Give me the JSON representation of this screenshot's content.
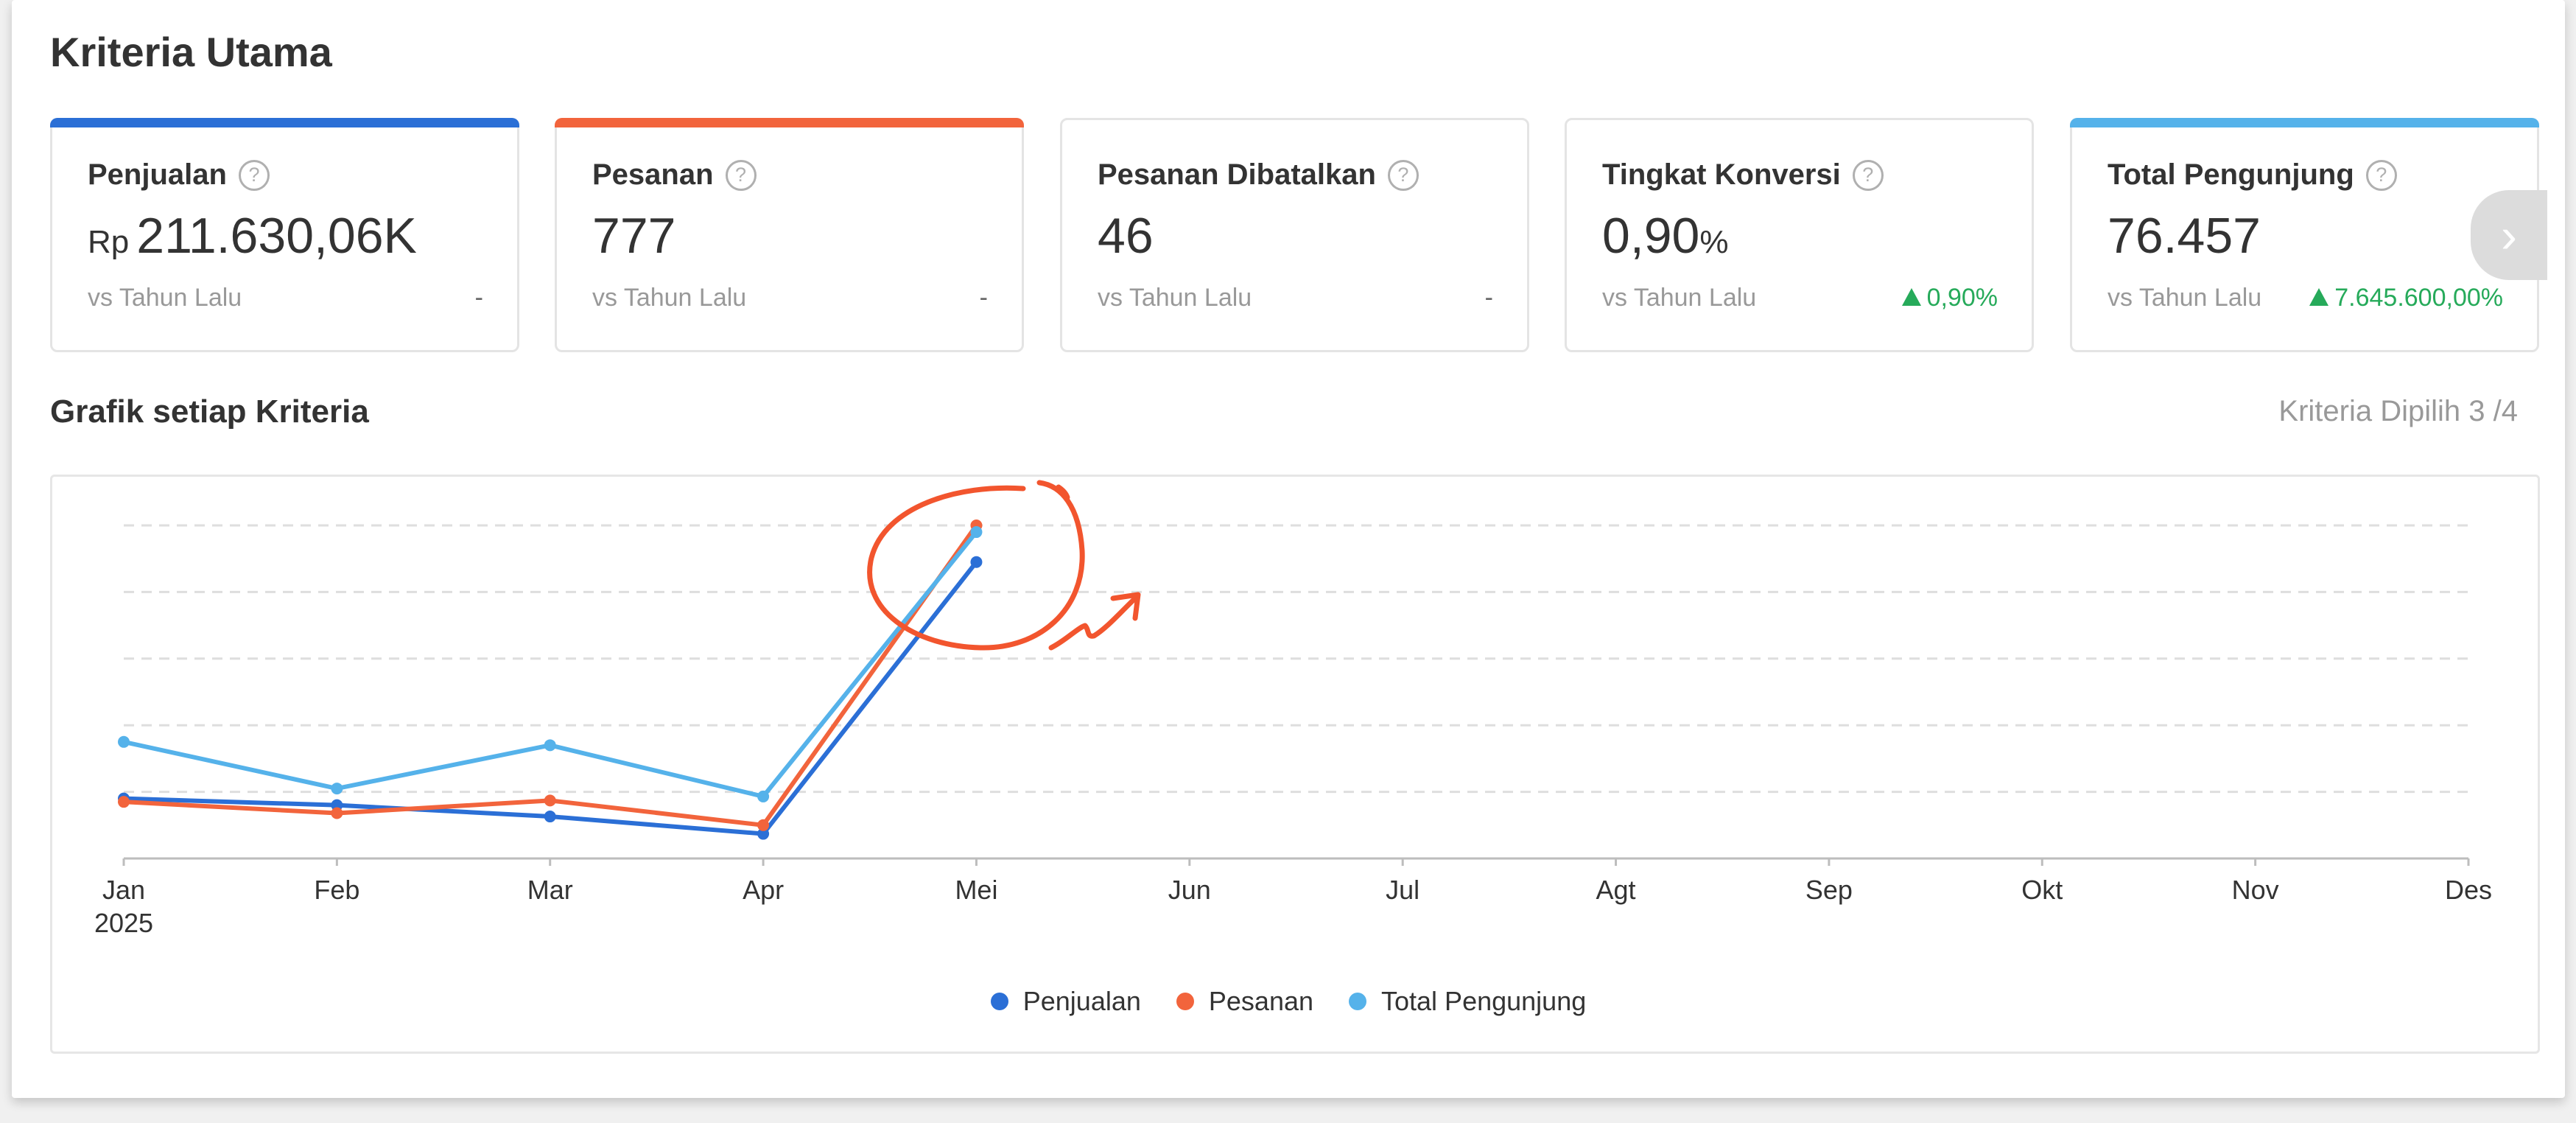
{
  "title": "Kriteria Utama",
  "cards": [
    {
      "label": "Penjualan",
      "prefix": "Rp",
      "value": "211.630,06K",
      "suffix": "",
      "vs": "vs Tahun Lalu",
      "delta": "-",
      "trend": "none",
      "accent": "#2b6fd6",
      "selected": true
    },
    {
      "label": "Pesanan",
      "prefix": "",
      "value": "777",
      "suffix": "",
      "vs": "vs Tahun Lalu",
      "delta": "-",
      "trend": "none",
      "accent": "#f2643c",
      "selected": true
    },
    {
      "label": "Pesanan Dibatalkan",
      "prefix": "",
      "value": "46",
      "suffix": "",
      "vs": "vs Tahun Lalu",
      "delta": "-",
      "trend": "none",
      "accent": "",
      "selected": false
    },
    {
      "label": "Tingkat Konversi",
      "prefix": "",
      "value": "0,90",
      "suffix": "%",
      "vs": "vs Tahun Lalu",
      "delta": "0,90%",
      "trend": "up",
      "accent": "",
      "selected": false
    },
    {
      "label": "Total Pengunjung",
      "prefix": "",
      "value": "76.457",
      "suffix": "",
      "vs": "vs Tahun Lalu",
      "delta": "7.645.600,00%",
      "trend": "up",
      "accent": "#55b2ea",
      "selected": true
    }
  ],
  "help_glyph": "?",
  "next_glyph": "›",
  "chart_title": "Grafik setiap Kriteria",
  "criteria_selected": "Kriteria Dipilih 3 /4",
  "chart_data": {
    "type": "line",
    "categories": [
      "Jan",
      "Feb",
      "Mar",
      "Apr",
      "Mei",
      "Jun",
      "Jul",
      "Agt",
      "Sep",
      "Okt",
      "Nov",
      "Des"
    ],
    "year_label": "2025",
    "ylim": [
      0,
      5
    ],
    "grid": true,
    "legend_position": "bottom",
    "series": [
      {
        "name": "Penjualan",
        "color": "#2b6fd6",
        "values": [
          0.9,
          0.8,
          0.63,
          0.37,
          4.45
        ]
      },
      {
        "name": "Pesanan",
        "color": "#f2643c",
        "values": [
          0.85,
          0.68,
          0.87,
          0.5,
          5.0
        ]
      },
      {
        "name": "Total Pengunjung",
        "color": "#55b2ea",
        "values": [
          1.75,
          1.05,
          1.7,
          0.93,
          4.9
        ]
      }
    ]
  },
  "annotation": {
    "color": "#f2552e"
  }
}
